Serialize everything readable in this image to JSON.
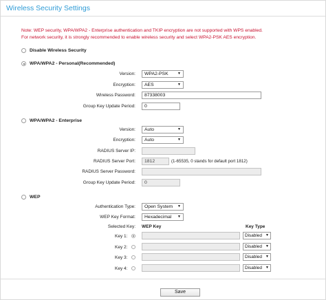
{
  "page": {
    "title": "Wireless Security Settings"
  },
  "notes": [
    "Note: WEP security, WPA/WPA2 - Enterprise authentication and TKIP encryption are not supported with WPS enabled.",
    "For network security, it is strongly recommended to enable wireless security and select WPA2-PSK AES encryption."
  ],
  "disable": {
    "label": "Disable Wireless Security",
    "selected": false
  },
  "personal": {
    "label": "WPA/WPA2 - Personal(Recommended)",
    "selected": true,
    "version_label": "Version:",
    "version_value": "WPA2-PSK",
    "encryption_label": "Encryption:",
    "encryption_value": "AES",
    "password_label": "Wireless Password:",
    "password_value": "87338003",
    "group_label": "Group Key Update Period:",
    "group_value": "0"
  },
  "enterprise": {
    "label": "WPA/WPA2 - Enterprise",
    "selected": false,
    "version_label": "Version:",
    "version_value": "Auto",
    "encryption_label": "Encryption:",
    "encryption_value": "Auto",
    "radius_ip_label": "RADIUS Server IP:",
    "radius_ip_value": "",
    "radius_port_label": "RADIUS Server Port:",
    "radius_port_value": "1812",
    "radius_port_hint": "(1-65535, 0 stands for default port 1812)",
    "radius_pw_label": "RADIUS Server Password:",
    "radius_pw_value": "",
    "group_label": "Group Key Update Period:",
    "group_value": "0"
  },
  "wep": {
    "label": "WEP",
    "selected": false,
    "auth_label": "Authentication Type:",
    "auth_value": "Open System",
    "format_label": "WEP Key Format:",
    "format_value": "Hexadecimal",
    "selected_key_label": "Selected Key:",
    "col_wep_key": "WEP Key",
    "col_key_type": "Key Type",
    "keys": [
      {
        "label": "Key 1:",
        "value": "",
        "type": "Disabled",
        "selected": true
      },
      {
        "label": "Key 2:",
        "value": "",
        "type": "Disabled",
        "selected": false
      },
      {
        "label": "Key 3:",
        "value": "",
        "type": "Disabled",
        "selected": false
      },
      {
        "label": "Key 4:",
        "value": "",
        "type": "Disabled",
        "selected": false
      }
    ]
  },
  "save_label": "Save"
}
